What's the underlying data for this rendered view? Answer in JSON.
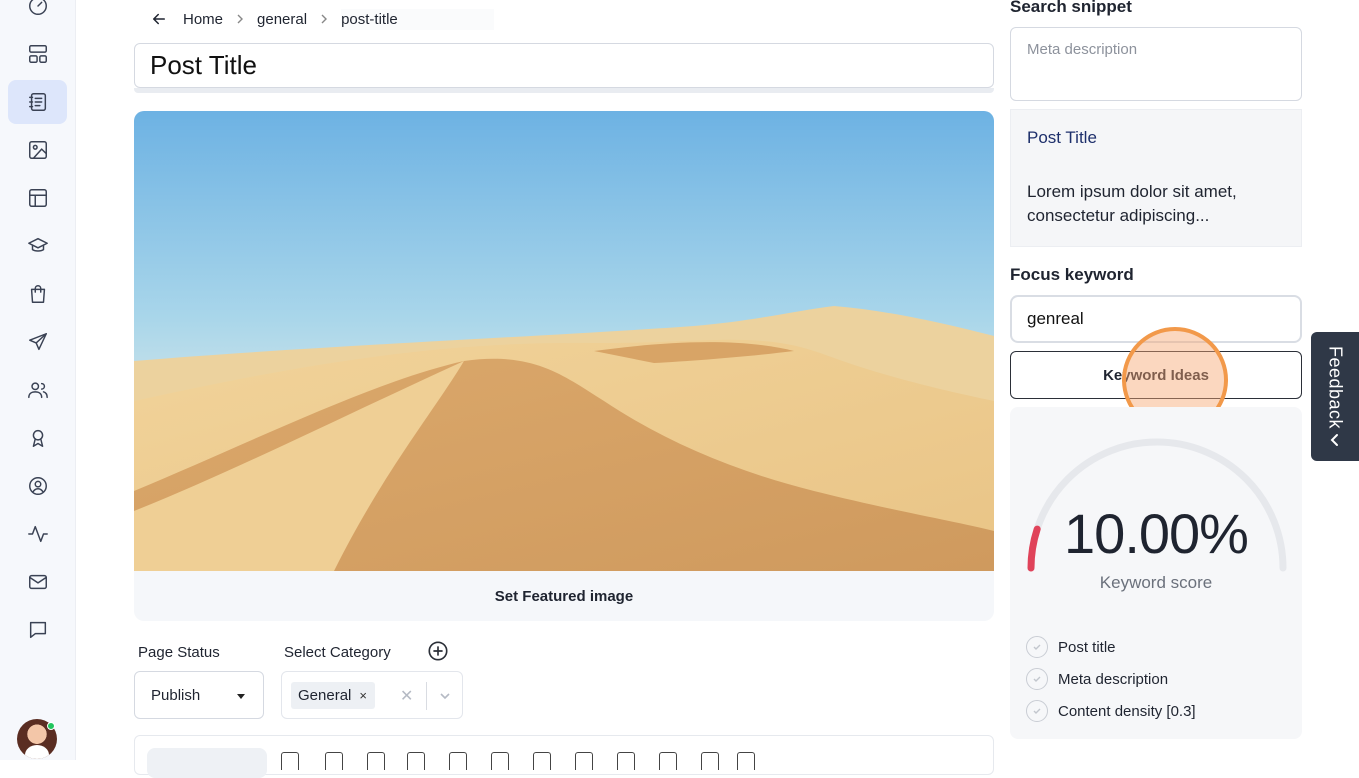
{
  "breadcrumb": {
    "items": [
      "Home",
      "general",
      "post-title"
    ]
  },
  "editor": {
    "title_value": "Post Title",
    "set_featured_label": "Set Featured image",
    "page_status_label": "Page Status",
    "page_status_value": "Publish",
    "select_category_label": "Select Category",
    "category_chip": "General",
    "chip_remove": "×",
    "clear_symbol": "✕"
  },
  "seo": {
    "snippet_heading": "Search snippet",
    "meta_placeholder": "Meta description",
    "preview_title": "Post Title",
    "preview_desc": "Lorem ipsum dolor sit amet, consectetur adipiscing...",
    "focus_heading": "Focus keyword",
    "focus_value": "genreal",
    "keyword_ideas_label": "Keyword Ideas",
    "score_value": "10.00%",
    "score_fraction": 0.1,
    "score_label": "Keyword score",
    "checks": [
      "Post title",
      "Meta description",
      "Content density [0.3]"
    ]
  },
  "feedback": {
    "label": "Feedback"
  },
  "colors": {
    "accent_active": "#dde6fb",
    "gauge_fill": "#e0435a",
    "cursor": "#f2994a",
    "feedback_bg": "#2f3847"
  },
  "sidebar": {
    "icons": [
      "dashboard-icon",
      "layout-icon",
      "posts-icon",
      "media-icon",
      "template-icon",
      "courses-icon",
      "shop-icon",
      "send-icon",
      "users-icon",
      "badge-icon",
      "profile-icon",
      "activity-icon",
      "mail-icon",
      "chat-icon"
    ]
  }
}
